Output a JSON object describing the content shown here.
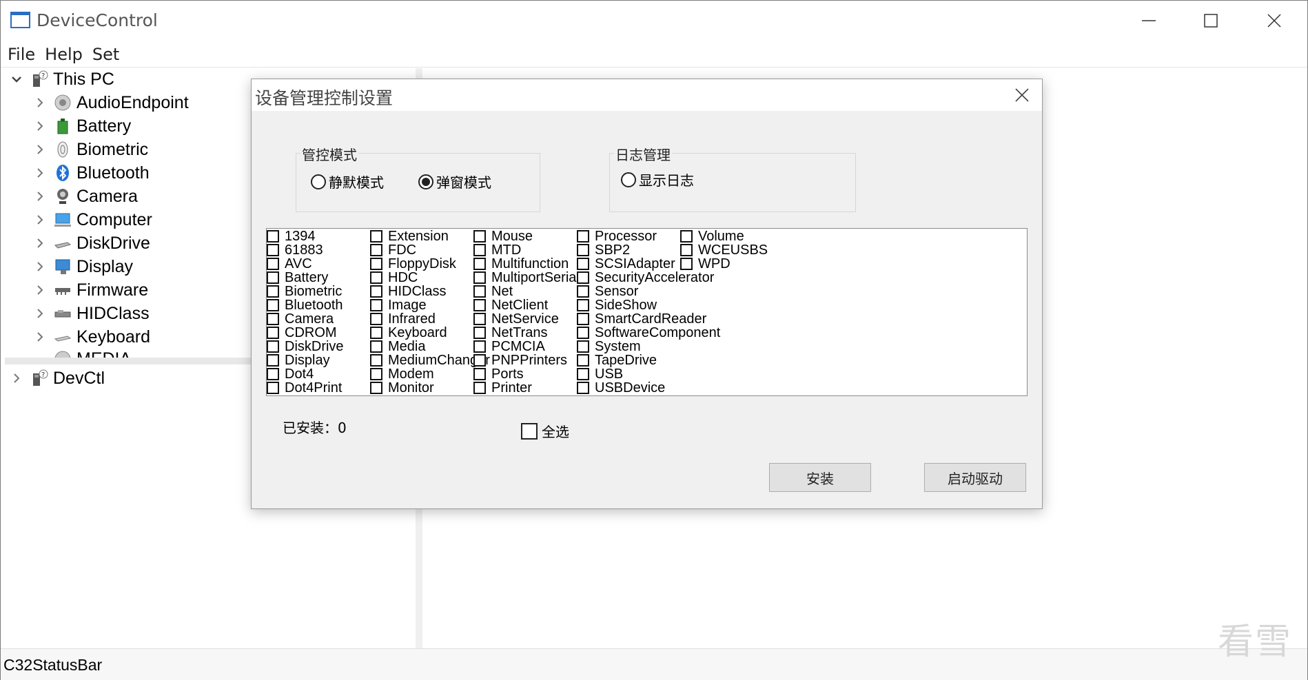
{
  "window": {
    "title": "DeviceControl"
  },
  "menu": [
    "File",
    "Help",
    "Set"
  ],
  "tree": {
    "root": "This PC",
    "children": [
      "AudioEndpoint",
      "Battery",
      "Biometric",
      "Bluetooth",
      "Camera",
      "Computer",
      "DiskDrive",
      "Display",
      "Firmware",
      "HIDClass",
      "Keyboard",
      "MEDIA"
    ],
    "second_root": "DevCtl"
  },
  "status": {
    "text": "C32StatusBar"
  },
  "watermark": "看雪",
  "dialog": {
    "title": "设备管理控制设置",
    "mode_group": {
      "label": "管控模式",
      "options": [
        {
          "label": "静默模式",
          "selected": false
        },
        {
          "label": "弹窗模式",
          "selected": true
        }
      ]
    },
    "log_group": {
      "label": "日志管理",
      "option": {
        "label": "显示日志",
        "selected": false
      }
    },
    "device_columns": [
      [
        "1394",
        "61883",
        "AVC",
        "Battery",
        "Biometric",
        "Bluetooth",
        "Camera",
        "CDROM",
        "DiskDrive",
        "Display",
        "Dot4",
        "Dot4Print"
      ],
      [
        "Extension",
        "FDC",
        "FloppyDisk",
        "HDC",
        "HIDClass",
        "Image",
        "Infrared",
        "Keyboard",
        "Media",
        "MediumChanger",
        "Modem",
        "Monitor"
      ],
      [
        "Mouse",
        "MTD",
        "Multifunction",
        "MultiportSerial",
        "Net",
        "NetClient",
        "NetService",
        "NetTrans",
        "PCMCIA",
        "PNPPrinters",
        "Ports",
        "Printer"
      ],
      [
        "Processor",
        "SBP2",
        "SCSIAdapter",
        "SecurityAccelerator",
        "Sensor",
        "SideShow",
        "SmartCardReader",
        "SoftwareComponent",
        "System",
        "TapeDrive",
        "USB",
        "USBDevice"
      ],
      [
        "Volume",
        "WCEUSBS",
        "WPD"
      ]
    ],
    "installed_label": "已安装：0",
    "select_all_label": "全选",
    "install_button": "安装",
    "start_driver_button": "启动驱动"
  }
}
